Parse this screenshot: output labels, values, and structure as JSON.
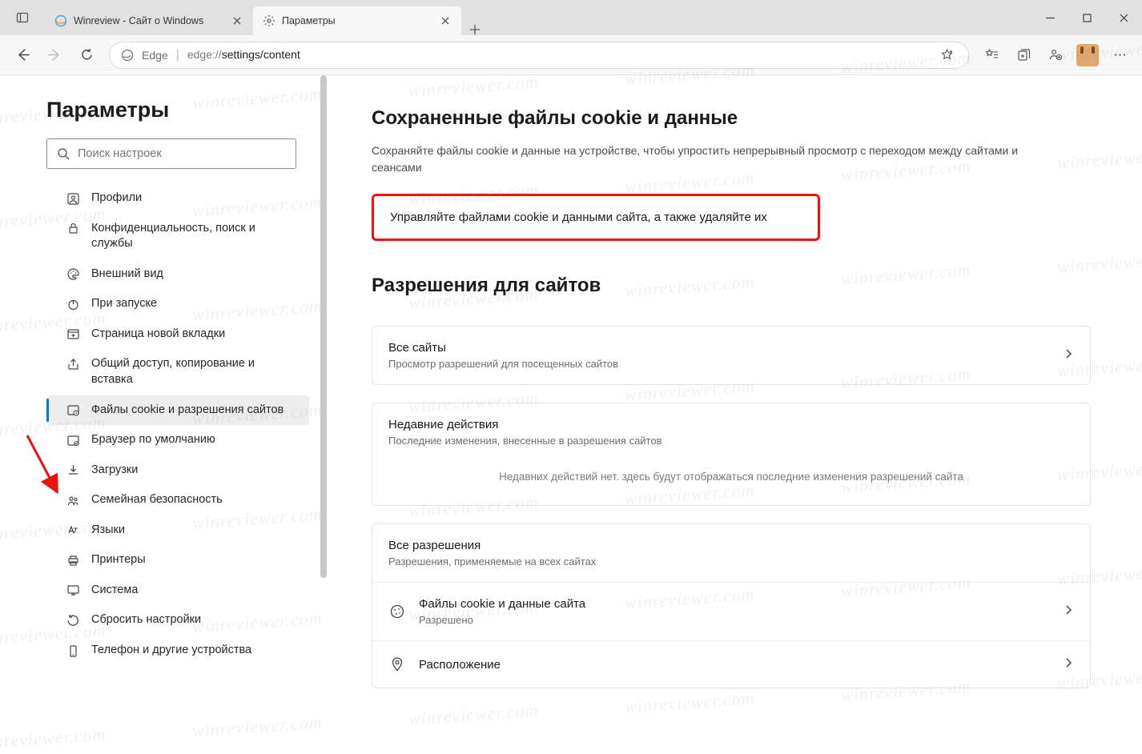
{
  "window": {
    "tab1_title": "Winreview - Сайт о Windows",
    "tab2_title": "Параметры"
  },
  "toolbar": {
    "scheme_label": "Edge",
    "url_scheme": "edge://",
    "url_path": "settings/content"
  },
  "sidebar": {
    "title": "Параметры",
    "search_placeholder": "Поиск настроек",
    "items": [
      {
        "label": "Профили"
      },
      {
        "label": "Конфиденциальность, поиск и службы"
      },
      {
        "label": "Внешний вид"
      },
      {
        "label": "При запуске"
      },
      {
        "label": "Страница новой вкладки"
      },
      {
        "label": "Общий доступ, копирование и вставка"
      },
      {
        "label": "Файлы cookie и разрешения сайтов"
      },
      {
        "label": "Браузер по умолчанию"
      },
      {
        "label": "Загрузки"
      },
      {
        "label": "Семейная безопасность"
      },
      {
        "label": "Языки"
      },
      {
        "label": "Принтеры"
      },
      {
        "label": "Система"
      },
      {
        "label": "Сбросить настройки"
      },
      {
        "label": "Телефон и другие устройства"
      }
    ]
  },
  "main": {
    "section1_title": "Сохраненные файлы cookie и данные",
    "section1_sub": "Сохраняйте файлы cookie и данные на устройстве, чтобы упростить непрерывный просмотр с переходом между сайтами и сеансами",
    "manage_row": "Управляйте файлами cookie и данными сайта, а также удаляйте их",
    "section2_title": "Разрешения для сайтов",
    "all_sites_title": "Все сайты",
    "all_sites_sub": "Просмотр разрешений для посещенных сайтов",
    "recent_title": "Недавние действия",
    "recent_sub": "Последние изменения, внесенные в разрешения сайтов",
    "recent_empty": "Недавних действий нет. здесь будут отображаться последние изменения разрешений сайта",
    "all_perm_title": "Все разрешения",
    "all_perm_sub": "Разрешения, применяемые на всех сайтах",
    "cookies_row_title": "Файлы cookie и данные сайта",
    "cookies_row_sub": "Разрешено",
    "location_row_title": "Расположение"
  },
  "watermark": "winreviewer.com"
}
